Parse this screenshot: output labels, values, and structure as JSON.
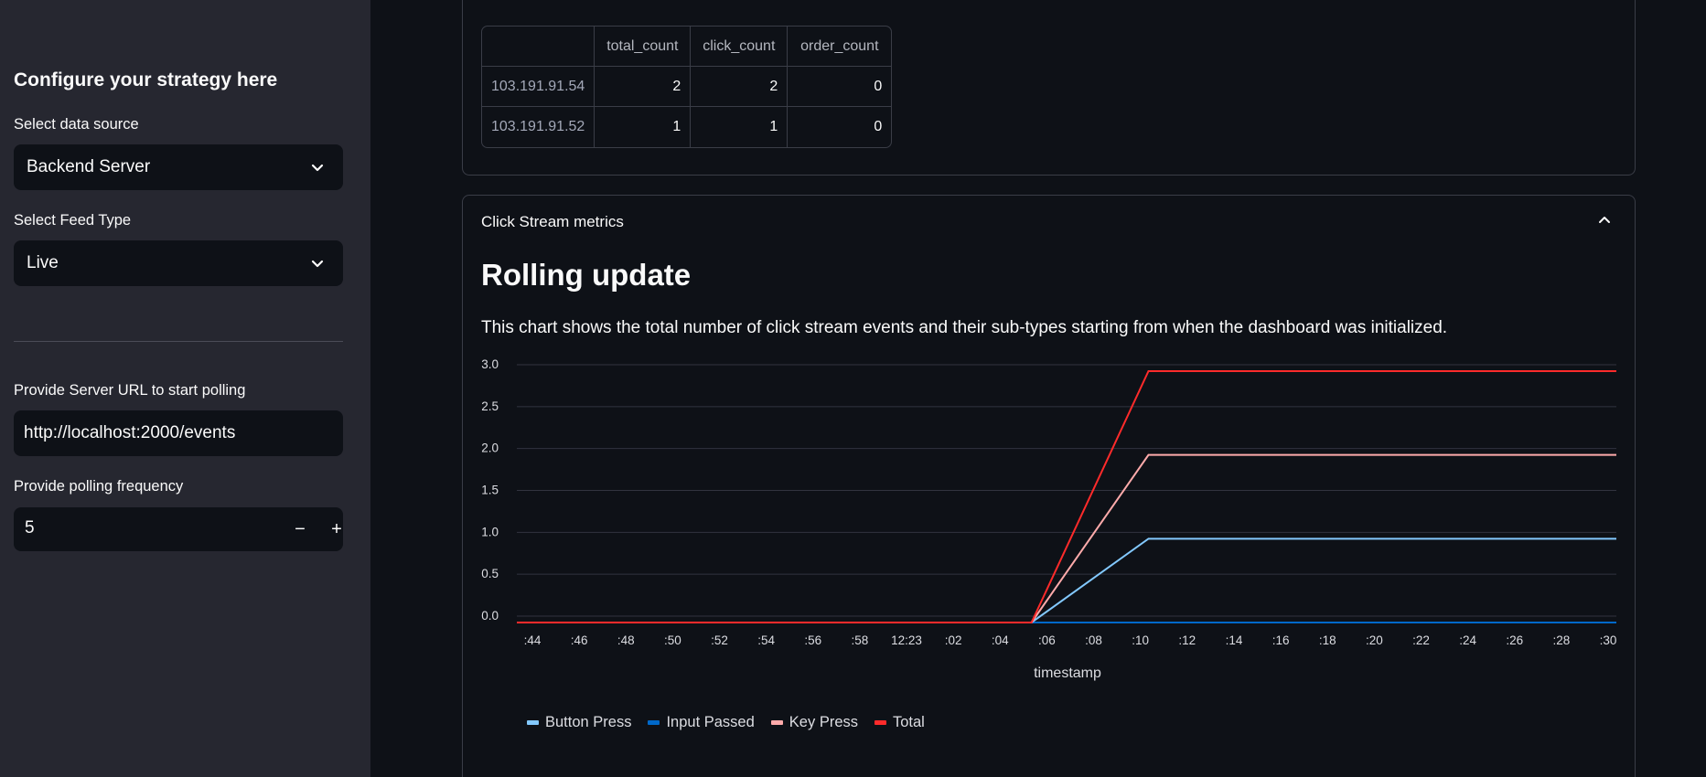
{
  "sidebar": {
    "title": "Configure your strategy here",
    "data_source_label": "Select data source",
    "data_source_value": "Backend Server",
    "feed_type_label": "Select Feed Type",
    "feed_type_value": "Live",
    "server_url_label": "Provide Server URL to start polling",
    "server_url_value": "http://localhost:2000/events",
    "polling_label": "Provide polling frequency",
    "polling_value": "5",
    "minus_label": "−",
    "plus_label": "+"
  },
  "table": {
    "columns": [
      "",
      "total_count",
      "click_count",
      "order_count"
    ],
    "rows": [
      {
        "index": "103.191.91.54",
        "total_count": "2",
        "click_count": "2",
        "order_count": "0"
      },
      {
        "index": "103.191.91.52",
        "total_count": "1",
        "click_count": "1",
        "order_count": "0"
      }
    ]
  },
  "expander": {
    "title": "Click Stream metrics"
  },
  "main": {
    "heading": "Rolling update",
    "description": "This chart shows the total number of click stream events and their sub-types starting from when the dashboard was initialized."
  },
  "colors": {
    "button_press": "#83c9ff",
    "input_passed": "#0068c9",
    "key_press": "#ffabab",
    "total": "#ff2b2b"
  },
  "chart_data": {
    "type": "line",
    "xlabel": "timestamp",
    "ylabel": "",
    "ylim": [
      0,
      3
    ],
    "yticks": [
      "0.0",
      "0.5",
      "1.0",
      "1.5",
      "2.0",
      "2.5",
      "3.0"
    ],
    "xticks": [
      ":44",
      ":46",
      ":48",
      ":50",
      ":52",
      ":54",
      ":56",
      ":58",
      "12:23",
      ":02",
      ":04",
      ":06",
      ":08",
      ":10",
      ":12",
      ":14",
      ":16",
      ":18",
      ":20",
      ":22",
      ":24",
      ":26",
      ":28",
      ":30"
    ],
    "x": [
      "12:22:43",
      "12:23:05",
      "12:23:10",
      "12:23:30"
    ],
    "grid": true,
    "legend_position": "bottom-left",
    "series": [
      {
        "name": "Button Press",
        "values": [
          0,
          0,
          1,
          1
        ]
      },
      {
        "name": "Input Passed",
        "values": [
          0,
          0,
          0,
          0
        ]
      },
      {
        "name": "Key Press",
        "values": [
          0,
          0,
          2,
          2
        ]
      },
      {
        "name": "Total",
        "values": [
          0,
          0,
          3,
          3
        ]
      }
    ]
  }
}
